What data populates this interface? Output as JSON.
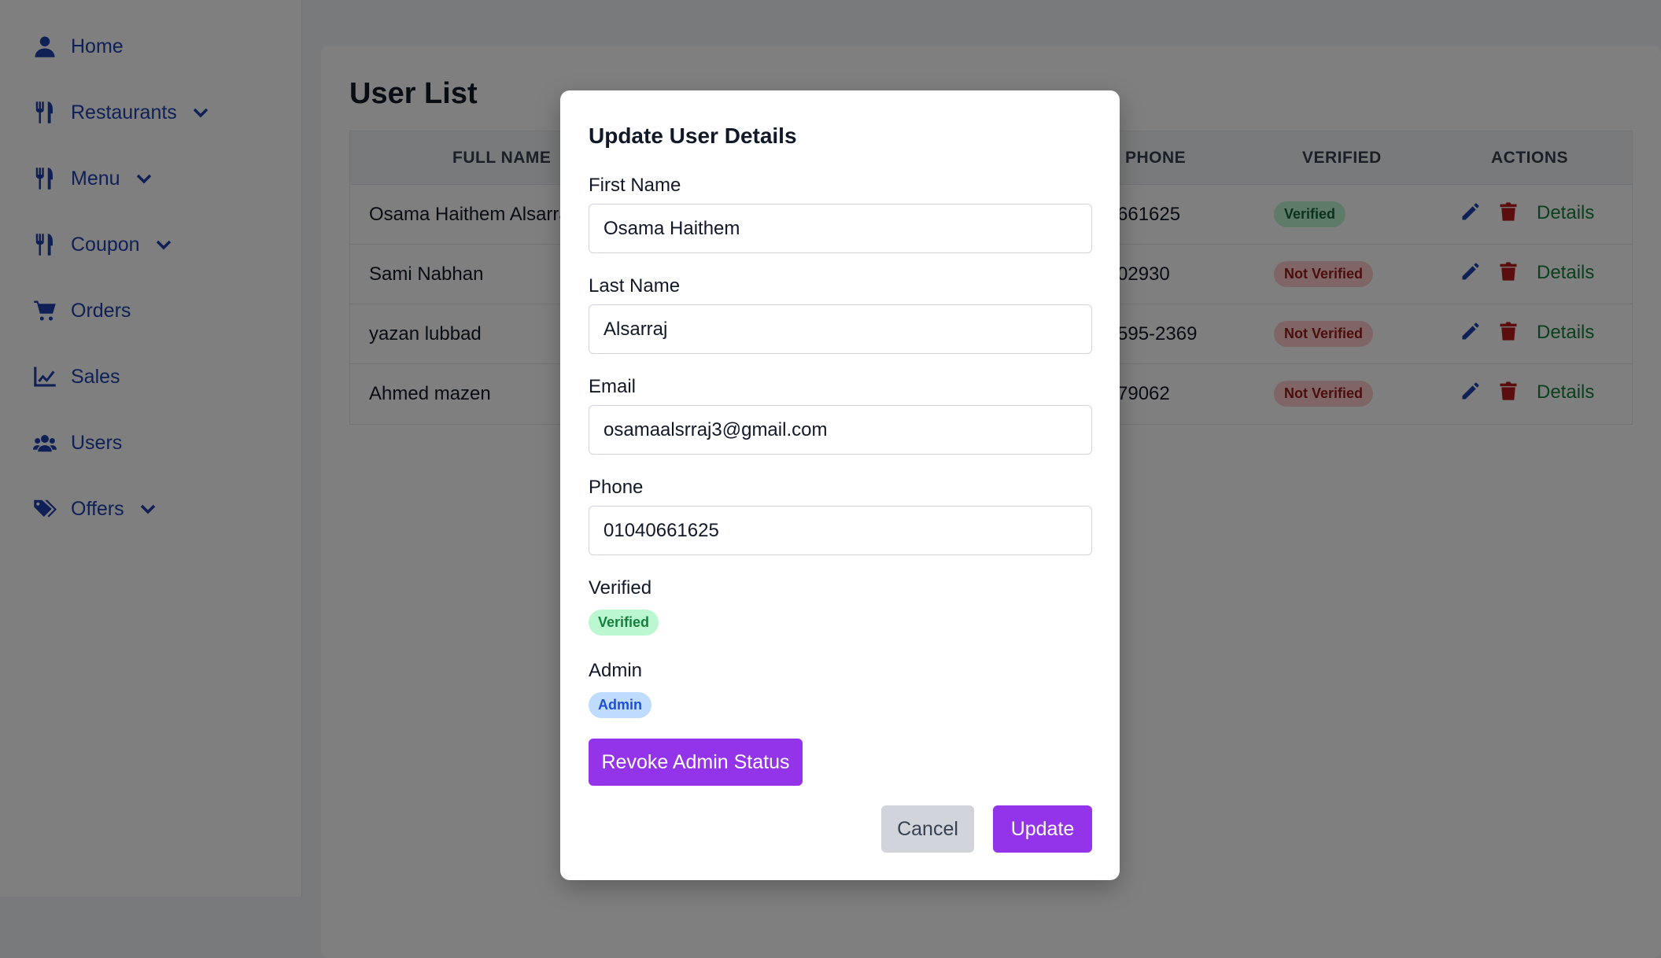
{
  "sidebar": {
    "items": [
      {
        "label": "Home",
        "icon": "user-icon",
        "has_dropdown": false
      },
      {
        "label": "Restaurants",
        "icon": "utensils-icon",
        "has_dropdown": true
      },
      {
        "label": "Menu",
        "icon": "utensils-icon",
        "has_dropdown": true
      },
      {
        "label": "Coupon",
        "icon": "utensils-icon",
        "has_dropdown": true
      },
      {
        "label": "Orders",
        "icon": "cart-icon",
        "has_dropdown": false
      },
      {
        "label": "Sales",
        "icon": "chart-line-icon",
        "has_dropdown": false
      },
      {
        "label": "Users",
        "icon": "users-icon",
        "has_dropdown": false
      },
      {
        "label": "Offers",
        "icon": "tags-icon",
        "has_dropdown": true
      }
    ]
  },
  "page": {
    "title": "User List"
  },
  "table": {
    "columns": {
      "full_name": "Full Name",
      "phone": "Phone",
      "verified": "Verified",
      "actions": "Actions"
    },
    "rows": [
      {
        "full_name": "Osama Haithem Alsarraj",
        "phone": "661625",
        "verified": "Verified",
        "details": "Details"
      },
      {
        "full_name": "Sami Nabhan",
        "phone": "02930",
        "verified": "Not Verified",
        "details": "Details"
      },
      {
        "full_name": "yazan lubbad",
        "phone": "595-2369",
        "verified": "Not Verified",
        "details": "Details"
      },
      {
        "full_name": "Ahmed mazen",
        "phone": "79062",
        "verified": "Not Verified",
        "details": "Details"
      }
    ]
  },
  "modal": {
    "title": "Update User Details",
    "first_name_label": "First Name",
    "first_name_value": "Osama Haithem",
    "last_name_label": "Last Name",
    "last_name_value": "Alsarraj",
    "email_label": "Email",
    "email_value": "osamaalsrraj3@gmail.com",
    "phone_label": "Phone",
    "phone_value": "01040661625",
    "verified_label": "Verified",
    "verified_badge": "Verified",
    "admin_label": "Admin",
    "admin_badge": "Admin",
    "revoke_button": "Revoke Admin Status",
    "cancel_button": "Cancel",
    "update_button": "Update"
  },
  "colors": {
    "sidebar_text": "#1e40af",
    "primary_button": "#9333ea",
    "cancel_button": "#d1d5db",
    "details_link": "#15803d",
    "edit_icon": "#1e40af",
    "delete_icon": "#b91c1c"
  }
}
